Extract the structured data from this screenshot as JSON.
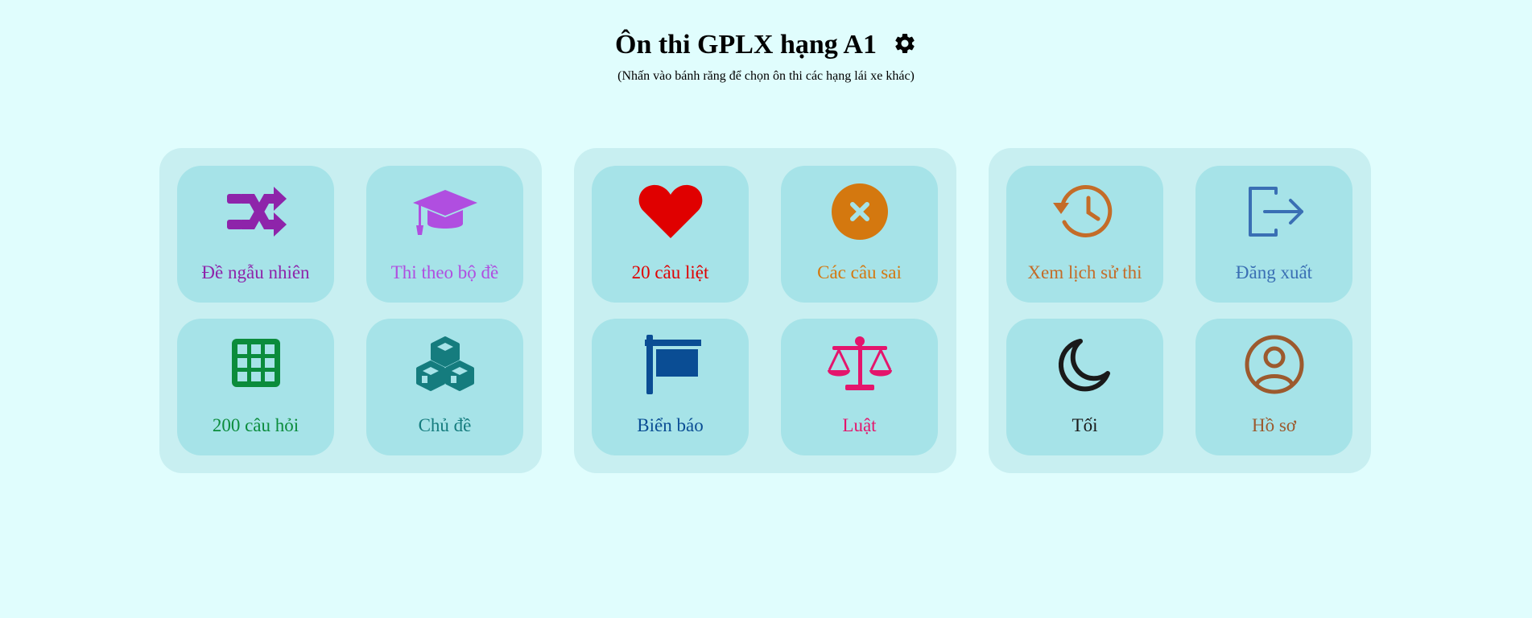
{
  "header": {
    "title": "Ôn thi GPLX hạng A1",
    "subtitle": "(Nhấn vào bánh răng để chọn ôn thi các hạng lái xe khác)",
    "settings_icon": "gear-icon"
  },
  "groups": [
    {
      "tiles": [
        {
          "label": "Đề ngẫu nhiên",
          "icon": "shuffle-icon",
          "color": "#8e24aa"
        },
        {
          "label": "Thi theo bộ đề",
          "icon": "graduation-cap-icon",
          "color": "#b04ee0"
        },
        {
          "label": "200 câu hỏi",
          "icon": "grid-icon",
          "color": "#0b8c3c"
        },
        {
          "label": "Chủ đề",
          "icon": "cubes-icon",
          "color": "#157c7e"
        }
      ]
    },
    {
      "tiles": [
        {
          "label": "20 câu liệt",
          "icon": "heart-icon",
          "color": "#e00000"
        },
        {
          "label": "Các câu sai",
          "icon": "x-circle-icon",
          "color": "#d4780f"
        },
        {
          "label": "Biển báo",
          "icon": "sign-icon",
          "color": "#0a4d94"
        },
        {
          "label": "Luật",
          "icon": "scale-icon",
          "color": "#e4156c"
        }
      ]
    },
    {
      "tiles": [
        {
          "label": "Xem lịch sử thi",
          "icon": "history-icon",
          "color": "#c46c28"
        },
        {
          "label": "Đăng xuất",
          "icon": "logout-icon",
          "color": "#3a6fb4"
        },
        {
          "label": "Tối",
          "icon": "moon-icon",
          "color": "#1a1a1a"
        },
        {
          "label": "Hồ sơ",
          "icon": "profile-icon",
          "color": "#9c5a2e"
        }
      ]
    }
  ]
}
